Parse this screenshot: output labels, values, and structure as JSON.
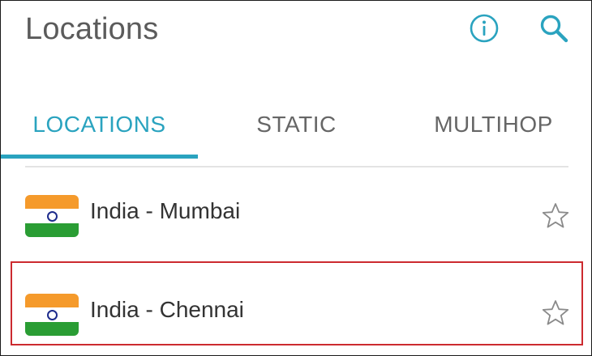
{
  "header": {
    "title": "Locations",
    "info_icon": "info-circle-icon",
    "search_icon": "search-icon"
  },
  "tabs": [
    {
      "label": "LOCATIONS",
      "active": true
    },
    {
      "label": "STATIC",
      "active": false
    },
    {
      "label": "MULTIHOP",
      "active": false
    }
  ],
  "locations": [
    {
      "name": "India - Mumbai",
      "flag": "india-flag-icon",
      "favorite": false,
      "highlighted": false
    },
    {
      "name": "India - Chennai",
      "flag": "india-flag-icon",
      "favorite": false,
      "highlighted": true
    }
  ],
  "colors": {
    "accent": "#2aa3bf",
    "highlight_border": "#cc2a2f",
    "tab_inactive": "#666666",
    "title": "#5b5b5b"
  }
}
